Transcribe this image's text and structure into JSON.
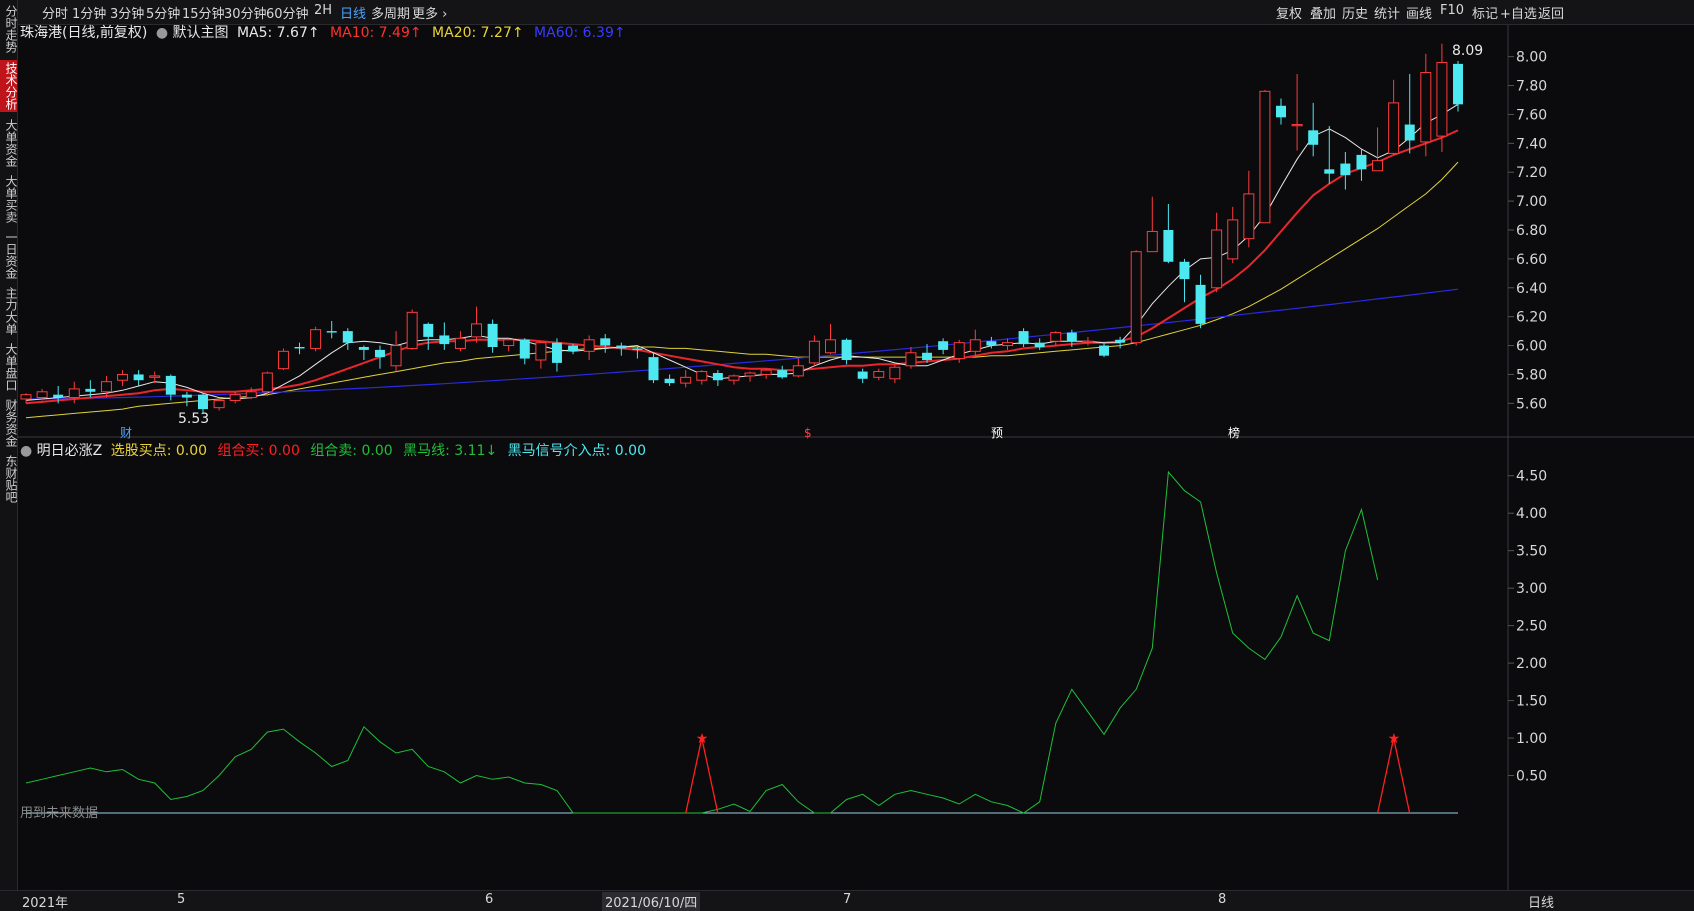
{
  "toolbar": {
    "periods": [
      "分时",
      "1分钟",
      "3分钟",
      "5分钟",
      "15分钟",
      "30分钟",
      "60分钟",
      "2H",
      "日线",
      "多周期",
      "更多"
    ],
    "active_period": "日线",
    "right_items": [
      "复权",
      "叠加",
      "历史",
      "统计",
      "画线",
      "F10",
      "标记",
      "+自选",
      "返回"
    ]
  },
  "leftnav": {
    "items": [
      "分时走势",
      "技术分析",
      "大单资金",
      "大单买卖",
      "一日资金",
      "主力大单",
      "大单盘口",
      "财务资金",
      "东财贴吧"
    ],
    "active": "技术分析"
  },
  "main_header": {
    "stock": "珠海港(日线,前复权)",
    "template": "默认主图",
    "ma5": "MA5: 7.67↑",
    "ma10": "MA10: 7.49↑",
    "ma20": "MA20: 7.27↑",
    "ma60": "MA60: 6.39↑"
  },
  "indicator_header": {
    "name": "明日必涨Z",
    "xuangu": "选股买点: 0.00",
    "zuhe_buy": "组合买: 0.00",
    "zuhe_sell": "组合卖: 0.00",
    "heima": "黑马线: 3.11↓",
    "heima_signal": "黑马信号介入点: 0.00"
  },
  "annotations": {
    "high_label": "8.09",
    "low_label": "5.53",
    "event_cai": "财",
    "event_s": "$",
    "event_yu": "预",
    "event_bang": "榜",
    "future_data_note": "用到未来数据"
  },
  "bottom": {
    "dates": [
      "2021年",
      "5",
      "6",
      "2021/06/10/四",
      "7",
      "8"
    ],
    "period": "日线"
  },
  "colors": {
    "up": "#ff3b3b",
    "down": "#4ee8f0",
    "ma5": "#e8e8e8",
    "ma10": "#e8262c",
    "ma20": "#e0d23a",
    "ma60": "#2a2ae0",
    "heima": "#1fbf3a",
    "signal": "#ff2020"
  },
  "chart_data": {
    "type": "candlestick",
    "y_axis": [
      "8.00",
      "7.80",
      "7.60",
      "7.40",
      "7.20",
      "7.00",
      "6.80",
      "6.60",
      "6.40",
      "6.20",
      "6.00",
      "5.80",
      "5.60"
    ],
    "ylim": [
      5.45,
      8.15
    ],
    "candles": [
      [
        5.63,
        5.66,
        5.6,
        5.67
      ],
      [
        5.64,
        5.68,
        5.62,
        5.7
      ],
      [
        5.66,
        5.64,
        5.6,
        5.72
      ],
      [
        5.64,
        5.7,
        5.6,
        5.75
      ],
      [
        5.7,
        5.68,
        5.64,
        5.76
      ],
      [
        5.68,
        5.75,
        5.64,
        5.79
      ],
      [
        5.76,
        5.8,
        5.72,
        5.83
      ],
      [
        5.8,
        5.76,
        5.72,
        5.83
      ],
      [
        5.78,
        5.79,
        5.74,
        5.82
      ],
      [
        5.79,
        5.66,
        5.62,
        5.8
      ],
      [
        5.66,
        5.64,
        5.58,
        5.68
      ],
      [
        5.66,
        5.56,
        5.53,
        5.67
      ],
      [
        5.57,
        5.62,
        5.55,
        5.63
      ],
      [
        5.62,
        5.66,
        5.6,
        5.68
      ],
      [
        5.64,
        5.68,
        5.63,
        5.71
      ],
      [
        5.68,
        5.81,
        5.65,
        5.82
      ],
      [
        5.84,
        5.96,
        5.83,
        5.98
      ],
      [
        5.99,
        5.98,
        5.94,
        6.02
      ],
      [
        5.98,
        6.11,
        5.96,
        6.13
      ],
      [
        6.1,
        6.09,
        6.05,
        6.17
      ],
      [
        6.1,
        6.02,
        5.97,
        6.12
      ],
      [
        5.99,
        5.97,
        5.9,
        6.0
      ],
      [
        5.97,
        5.92,
        5.84,
        6.0
      ],
      [
        5.86,
        6.0,
        5.82,
        6.1
      ],
      [
        5.98,
        6.23,
        5.97,
        6.25
      ],
      [
        6.15,
        6.06,
        5.97,
        6.16
      ],
      [
        6.07,
        6.01,
        5.97,
        6.16
      ],
      [
        5.98,
        6.05,
        5.96,
        6.1
      ],
      [
        6.06,
        6.15,
        6.02,
        6.27
      ],
      [
        6.15,
        5.99,
        5.95,
        6.18
      ],
      [
        6.0,
        6.04,
        5.96,
        6.05
      ],
      [
        6.04,
        5.91,
        5.87,
        6.05
      ],
      [
        5.9,
        6.02,
        5.84,
        6.03
      ],
      [
        6.02,
        5.88,
        5.82,
        6.05
      ],
      [
        6.0,
        5.96,
        5.94,
        6.01
      ],
      [
        5.96,
        6.04,
        5.9,
        6.07
      ],
      [
        6.05,
        6.0,
        5.95,
        6.08
      ],
      [
        6.0,
        5.98,
        5.93,
        6.02
      ],
      [
        5.98,
        5.97,
        5.91,
        5.99
      ],
      [
        5.92,
        5.76,
        5.74,
        5.95
      ],
      [
        5.77,
        5.74,
        5.72,
        5.8
      ],
      [
        5.74,
        5.78,
        5.71,
        5.83
      ],
      [
        5.76,
        5.82,
        5.73,
        5.83
      ],
      [
        5.81,
        5.76,
        5.72,
        5.83
      ],
      [
        5.76,
        5.79,
        5.73,
        5.8
      ],
      [
        5.79,
        5.81,
        5.75,
        5.82
      ],
      [
        5.8,
        5.83,
        5.77,
        5.84
      ],
      [
        5.83,
        5.78,
        5.77,
        5.86
      ],
      [
        5.79,
        5.86,
        5.78,
        5.91
      ],
      [
        5.88,
        6.03,
        5.86,
        6.07
      ],
      [
        5.95,
        6.04,
        5.94,
        6.15
      ],
      [
        6.04,
        5.9,
        5.87,
        6.05
      ],
      [
        5.82,
        5.77,
        5.74,
        5.84
      ],
      [
        5.78,
        5.82,
        5.76,
        5.84
      ],
      [
        5.77,
        5.85,
        5.74,
        5.87
      ],
      [
        5.86,
        5.95,
        5.84,
        5.99
      ],
      [
        5.95,
        5.9,
        5.88,
        6.01
      ],
      [
        6.03,
        5.97,
        5.94,
        6.05
      ],
      [
        5.91,
        6.02,
        5.88,
        6.04
      ],
      [
        5.96,
        6.04,
        5.93,
        6.11
      ],
      [
        6.03,
        6.0,
        5.98,
        6.06
      ],
      [
        6.0,
        6.02,
        5.97,
        6.05
      ],
      [
        6.1,
        6.01,
        5.99,
        6.12
      ],
      [
        6.02,
        5.99,
        5.97,
        6.05
      ],
      [
        6.03,
        6.09,
        6.0,
        6.1
      ],
      [
        6.09,
        6.03,
        5.99,
        6.11
      ],
      [
        6.03,
        6.03,
        6.0,
        6.06
      ],
      [
        6.0,
        5.93,
        5.92,
        6.02
      ],
      [
        6.04,
        6.02,
        5.98,
        6.06
      ],
      [
        6.02,
        6.65,
        6.0,
        6.66
      ],
      [
        6.65,
        6.79,
        6.66,
        7.03
      ],
      [
        6.8,
        6.58,
        6.57,
        6.98
      ],
      [
        6.58,
        6.46,
        6.3,
        6.6
      ],
      [
        6.42,
        6.15,
        6.12,
        6.49
      ],
      [
        6.4,
        6.8,
        6.37,
        6.92
      ],
      [
        6.6,
        6.87,
        6.57,
        6.96
      ],
      [
        6.74,
        7.05,
        6.68,
        7.21
      ],
      [
        6.85,
        7.76,
        6.85,
        7.77
      ],
      [
        7.66,
        7.58,
        7.53,
        7.71
      ],
      [
        7.53,
        7.53,
        7.35,
        7.88
      ],
      [
        7.49,
        7.39,
        7.31,
        7.68
      ],
      [
        7.22,
        7.19,
        7.12,
        7.52
      ],
      [
        7.26,
        7.18,
        7.08,
        7.34
      ],
      [
        7.32,
        7.22,
        7.14,
        7.36
      ],
      [
        7.21,
        7.28,
        7.22,
        7.51
      ],
      [
        7.33,
        7.68,
        7.32,
        7.84
      ],
      [
        7.53,
        7.42,
        7.33,
        7.88
      ],
      [
        7.41,
        7.89,
        7.31,
        8.02
      ],
      [
        7.45,
        7.96,
        7.34,
        8.09
      ],
      [
        7.95,
        7.67,
        7.62,
        7.97
      ]
    ],
    "ma5": [
      5.62,
      5.63,
      5.64,
      5.65,
      5.66,
      5.67,
      5.69,
      5.72,
      5.75,
      5.74,
      5.71,
      5.67,
      5.64,
      5.63,
      5.64,
      5.67,
      5.73,
      5.79,
      5.87,
      5.95,
      6.02,
      6.03,
      6.02,
      6.0,
      6.03,
      6.04,
      6.04,
      6.05,
      6.07,
      6.05,
      6.05,
      6.03,
      6.0,
      5.97,
      5.96,
      5.97,
      5.98,
      5.99,
      6.0,
      5.95,
      5.9,
      5.85,
      5.8,
      5.77,
      5.78,
      5.79,
      5.8,
      5.8,
      5.81,
      5.86,
      5.9,
      5.93,
      5.92,
      5.91,
      5.88,
      5.86,
      5.86,
      5.9,
      5.94,
      5.97,
      6.0,
      6.01,
      6.02,
      6.01,
      6.03,
      6.03,
      6.03,
      6.02,
      6.02,
      6.14,
      6.29,
      6.41,
      6.52,
      6.6,
      6.61,
      6.66,
      6.76,
      6.9,
      7.1,
      7.29,
      7.45,
      7.5,
      7.44,
      7.36,
      7.3,
      7.35,
      7.44,
      7.54,
      7.6,
      7.67
    ],
    "ma10": [
      5.6,
      5.61,
      5.62,
      5.63,
      5.64,
      5.65,
      5.66,
      5.67,
      5.69,
      5.7,
      5.69,
      5.68,
      5.68,
      5.68,
      5.69,
      5.7,
      5.71,
      5.73,
      5.76,
      5.8,
      5.84,
      5.88,
      5.92,
      5.96,
      6.0,
      6.02,
      6.03,
      6.03,
      6.04,
      6.04,
      6.04,
      6.04,
      6.03,
      6.02,
      6.01,
      6.0,
      5.99,
      5.98,
      5.97,
      5.95,
      5.93,
      5.91,
      5.89,
      5.87,
      5.85,
      5.84,
      5.84,
      5.83,
      5.83,
      5.84,
      5.85,
      5.86,
      5.86,
      5.87,
      5.87,
      5.88,
      5.89,
      5.9,
      5.91,
      5.93,
      5.95,
      5.96,
      5.98,
      5.99,
      6.0,
      6.01,
      6.02,
      6.02,
      6.03,
      6.06,
      6.12,
      6.19,
      6.26,
      6.33,
      6.39,
      6.46,
      6.55,
      6.66,
      6.79,
      6.92,
      7.04,
      7.12,
      7.19,
      7.23,
      7.27,
      7.32,
      7.36,
      7.4,
      7.44,
      7.49
    ],
    "ma20": [
      5.5,
      5.51,
      5.52,
      5.53,
      5.54,
      5.55,
      5.56,
      5.58,
      5.59,
      5.6,
      5.61,
      5.62,
      5.63,
      5.64,
      5.65,
      5.66,
      5.68,
      5.7,
      5.72,
      5.74,
      5.76,
      5.78,
      5.8,
      5.82,
      5.84,
      5.86,
      5.88,
      5.89,
      5.91,
      5.92,
      5.93,
      5.94,
      5.95,
      5.96,
      5.97,
      5.98,
      5.98,
      5.99,
      5.99,
      5.99,
      5.98,
      5.98,
      5.97,
      5.96,
      5.95,
      5.94,
      5.94,
      5.93,
      5.92,
      5.92,
      5.92,
      5.92,
      5.92,
      5.92,
      5.92,
      5.92,
      5.92,
      5.92,
      5.92,
      5.92,
      5.93,
      5.93,
      5.94,
      5.95,
      5.96,
      5.97,
      5.98,
      5.99,
      6.0,
      6.02,
      6.05,
      6.08,
      6.11,
      6.14,
      6.18,
      6.22,
      6.27,
      6.33,
      6.39,
      6.46,
      6.53,
      6.6,
      6.67,
      6.74,
      6.81,
      6.89,
      6.97,
      7.05,
      7.15,
      7.27
    ],
    "ma60_start": 5.63,
    "ma60_end": 6.39,
    "heima": [
      0.4,
      0.45,
      0.5,
      0.55,
      0.6,
      0.55,
      0.58,
      0.45,
      0.4,
      0.18,
      0.22,
      0.3,
      0.5,
      0.75,
      0.85,
      1.08,
      1.12,
      0.95,
      0.8,
      0.62,
      0.7,
      1.15,
      0.95,
      0.8,
      0.85,
      0.62,
      0.55,
      0.4,
      0.5,
      0.45,
      0.48,
      0.4,
      0.38,
      0.3,
      0.0,
      0.0,
      0.0,
      0.0,
      0.0,
      0.0,
      0.0,
      0.0,
      0.0,
      0.05,
      0.12,
      0.02,
      0.3,
      0.38,
      0.15,
      0.0,
      0.0,
      0.18,
      0.25,
      0.1,
      0.25,
      0.3,
      0.25,
      0.2,
      0.12,
      0.25,
      0.15,
      0.1,
      0.0,
      0.15,
      1.2,
      1.65,
      1.35,
      1.05,
      1.4,
      1.65,
      2.2,
      4.55,
      4.3,
      4.15,
      3.2,
      2.4,
      2.2,
      2.05,
      2.35,
      2.9,
      2.4,
      2.3,
      3.5,
      4.05,
      3.11
    ],
    "heima_ylim": [
      0,
      4.75
    ],
    "heima_y_axis": [
      "4.50",
      "4.00",
      "3.50",
      "3.00",
      "2.50",
      "2.00",
      "1.50",
      "1.00",
      "0.50"
    ],
    "signals_index": [
      42,
      85
    ]
  }
}
